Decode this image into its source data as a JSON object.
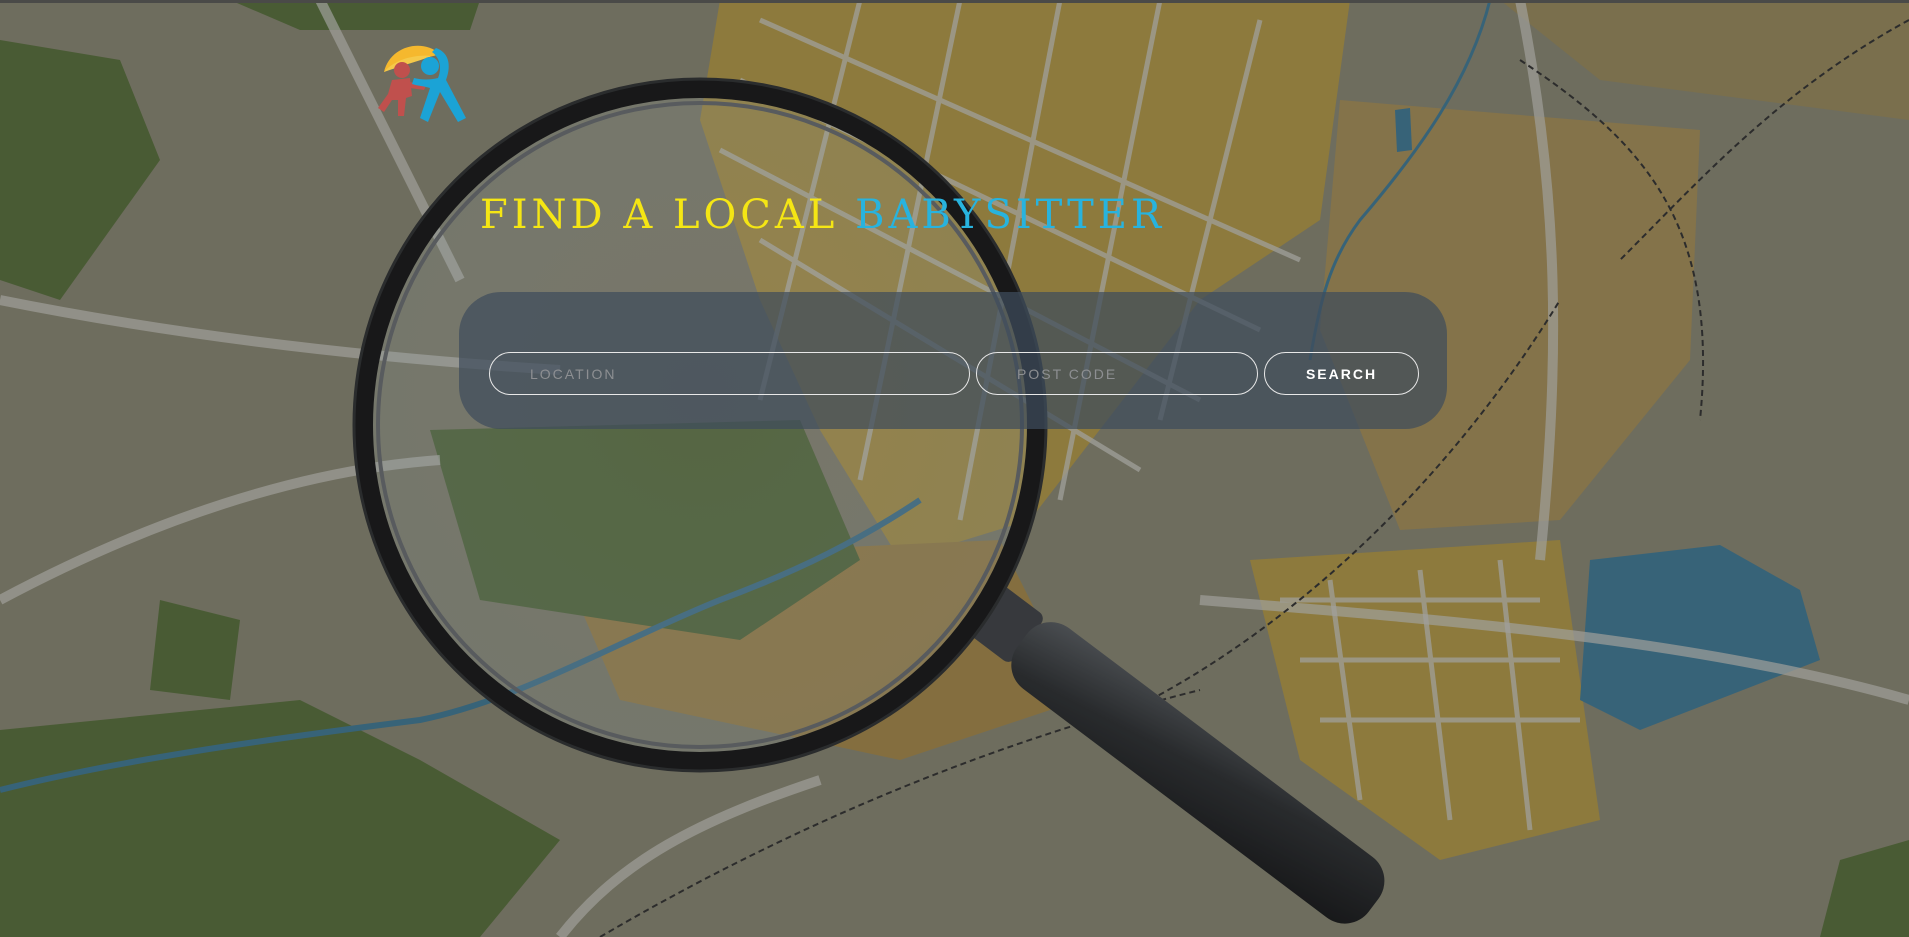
{
  "hero": {
    "headline_part1": "FIND A LOCAL",
    "headline_part2": "BABYSITTER"
  },
  "search": {
    "location_placeholder": "LOCATION",
    "postcode_placeholder": "POST CODE",
    "button_label": "SEARCH"
  },
  "colors": {
    "headline_yellow": "#f5e614",
    "headline_blue": "#28b3de",
    "panel_bg": "#3e4c5c",
    "logo_yellow": "#f5b82e",
    "logo_red": "#c0504d",
    "logo_blue": "#1ba3d6"
  },
  "icons": {
    "logo": "babysitter-logo-icon",
    "background": "map-with-magnifying-glass"
  }
}
